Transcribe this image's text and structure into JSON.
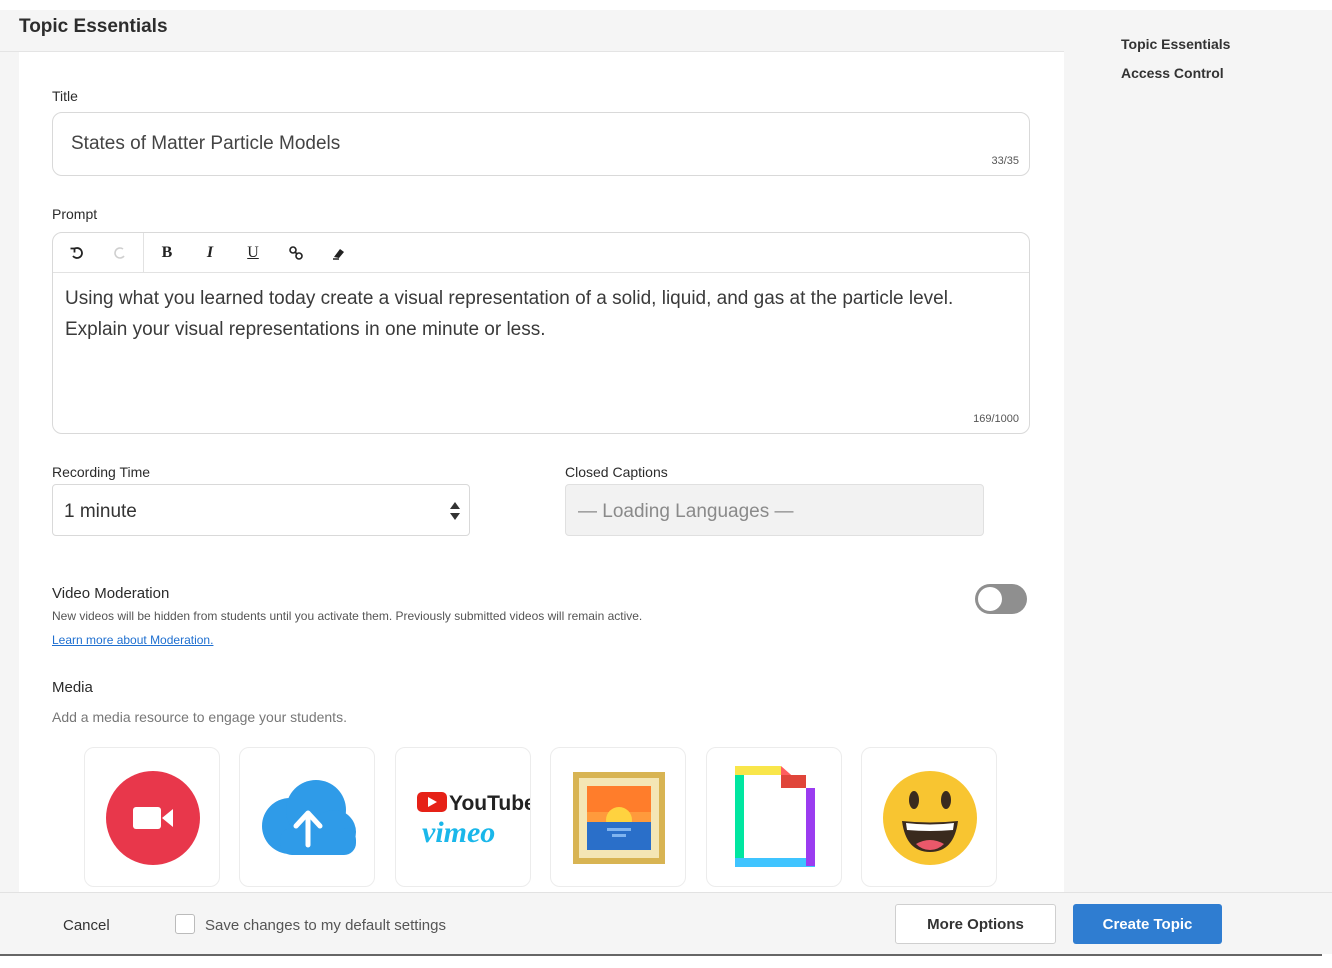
{
  "header": {
    "title": "Topic Essentials"
  },
  "sidebar": {
    "items": [
      {
        "label": "Topic Essentials"
      },
      {
        "label": "Access Control"
      }
    ]
  },
  "form": {
    "title_label": "Title",
    "title_value": "States of Matter Particle Models",
    "title_counter": "33/35",
    "prompt_label": "Prompt",
    "prompt_text": "Using what you learned today create a visual representation of a solid, liquid, and gas at the particle level. Explain your visual representations in one minute or less.",
    "prompt_counter": "169/1000",
    "toolbar": {
      "bold": "B",
      "italic": "I",
      "underline": "U"
    },
    "recording_label": "Recording Time",
    "recording_value": "1 minute",
    "captions_label": "Closed Captions",
    "captions_value": "— Loading Languages —",
    "moderation": {
      "title": "Video Moderation",
      "description": "New videos will be hidden from students until you activate them. Previously submitted videos will remain active.",
      "link": "Learn more about Moderation.",
      "enabled": false
    },
    "media": {
      "title": "Media",
      "description": "Add a media resource to engage your students.",
      "tiles": [
        {
          "icon": "video-record-icon"
        },
        {
          "icon": "cloud-upload-icon"
        },
        {
          "icon": "youtube-vimeo-icon",
          "line1": "YouTube",
          "line2": "vimeo"
        },
        {
          "icon": "image-frame-icon"
        },
        {
          "icon": "gif-icon"
        },
        {
          "icon": "emoji-icon"
        }
      ]
    }
  },
  "footer": {
    "cancel": "Cancel",
    "save_default": "Save changes to my default settings",
    "more_options": "More Options",
    "create": "Create Topic"
  },
  "colors": {
    "accent": "#2f7dd1",
    "link": "#1e6fd0",
    "panel_bg": "#f5f5f5"
  }
}
